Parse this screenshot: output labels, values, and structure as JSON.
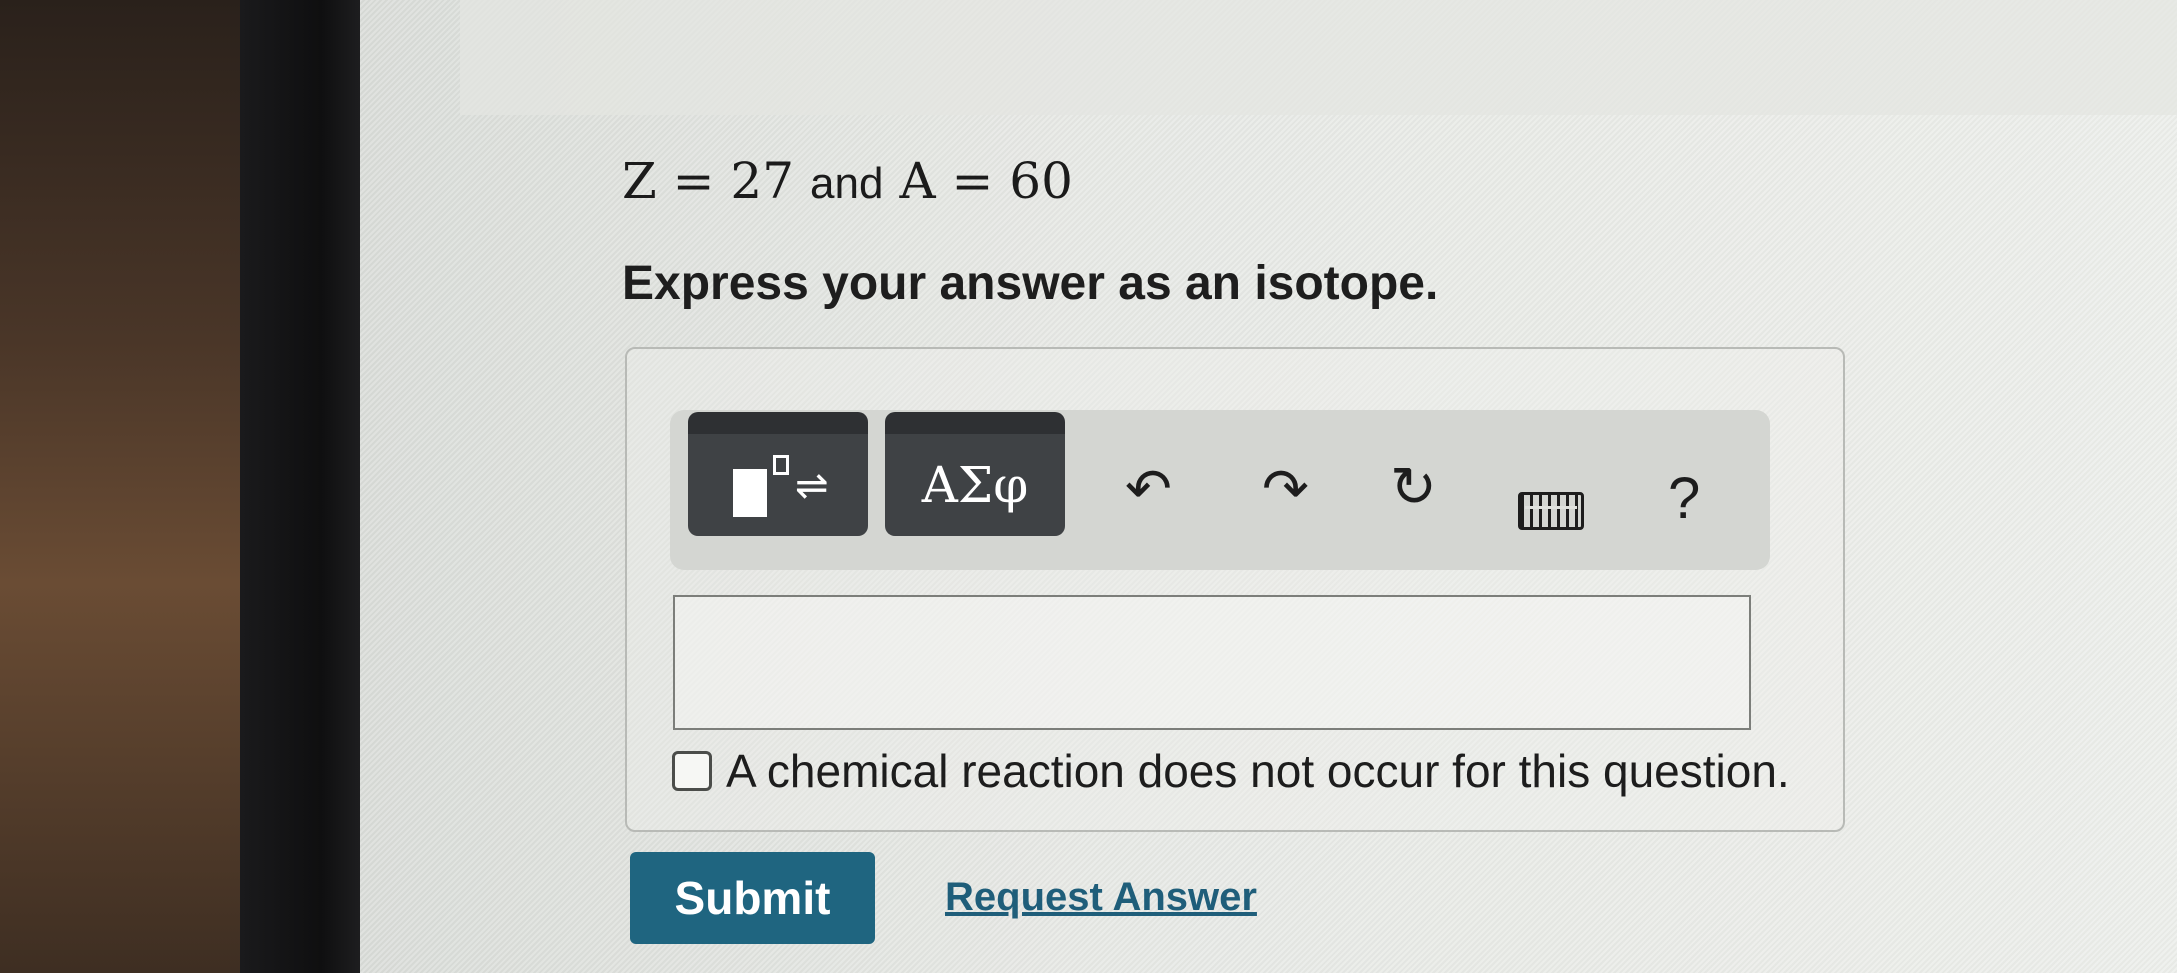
{
  "question": {
    "math_left": "Z = 27",
    "conjunction": "and",
    "math_right": "A = 60"
  },
  "instruction": "Express your answer as an isotope.",
  "toolbar": {
    "templates_icon": "templates-icon",
    "symbols_label": "ΑΣφ",
    "undo_glyph": "↶",
    "redo_glyph": "↷",
    "reset_glyph": "↻",
    "keyboard_icon": "keyboard-icon",
    "help_label": "?"
  },
  "answer": {
    "value": ""
  },
  "no_reaction": {
    "label": "A chemical reaction does not occur for this question.",
    "checked": false
  },
  "actions": {
    "submit_label": "Submit",
    "request_label": "Request Answer"
  },
  "colors": {
    "submit_bg": "#1f6580",
    "link": "#1f5e7a",
    "toolbar_button": "#3f4245"
  }
}
